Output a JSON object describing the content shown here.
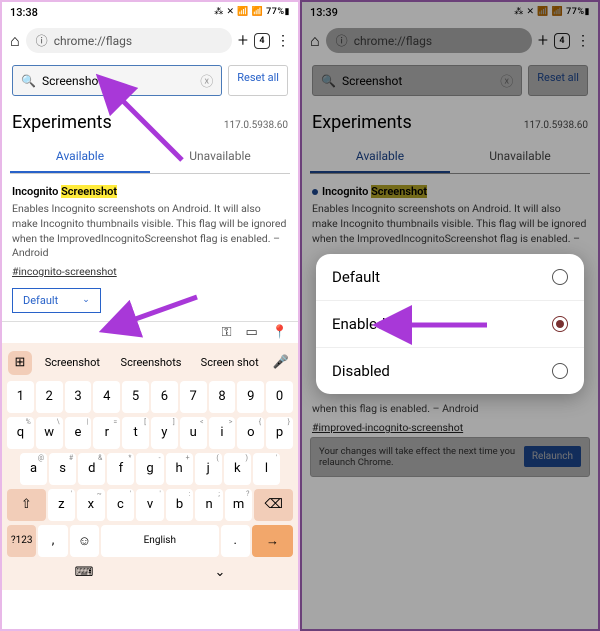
{
  "left": {
    "status": {
      "time": "13:38",
      "icons": "⁂ ✕ 📶 📶 77%▮"
    },
    "nav": {
      "url": "chrome://flags",
      "tabcount": "4"
    },
    "search": {
      "value": "Screenshot",
      "reset": "Reset all"
    },
    "experiments": {
      "title": "Experiments",
      "version": "117.0.5938.60"
    },
    "tabs": {
      "available": "Available",
      "unavailable": "Unavailable"
    },
    "flag": {
      "title_pre": "Incognito ",
      "title_hl": "Screenshot",
      "desc": "Enables Incognito screenshots on Android. It will also make Incognito thumbnails visible. This flag will be ignored when the ImprovedIncognitoScreenshot flag is enabled. – Android",
      "link": "#incognito-screenshot",
      "dropdown": "Default"
    },
    "suggest": {
      "w1": "Screenshot",
      "w2": "Screenshots",
      "w3": "Screen shot"
    },
    "keys": {
      "r1": [
        "1",
        "2",
        "3",
        "4",
        "5",
        "6",
        "7",
        "8",
        "9",
        "0"
      ],
      "r2": [
        "q",
        "w",
        "e",
        "r",
        "t",
        "y",
        "u",
        "i",
        "o",
        "p"
      ],
      "r2sup": [
        "%",
        "\\",
        "|",
        "=",
        "[",
        "]",
        "<",
        ">",
        "{",
        "}"
      ],
      "r3": [
        "a",
        "s",
        "d",
        "f",
        "g",
        "h",
        "j",
        "k",
        "l"
      ],
      "r3sup": [
        "@",
        "#",
        "&",
        "*",
        "-",
        "+",
        "(",
        ")",
        "'"
      ],
      "r4": [
        "z",
        "x",
        "c",
        "v",
        "b",
        "n",
        "m"
      ],
      "r4sup": [
        "'",
        "~",
        "'",
        "'",
        ":",
        ";",
        "?"
      ],
      "shift": "⇧",
      "back": "⌫",
      "num": "?123",
      "emoji": "☺",
      "space": "English",
      "enter": "→"
    }
  },
  "right": {
    "status": {
      "time": "13:39",
      "icons": "⁂ ✕ 📶 📶 77%▮"
    },
    "nav": {
      "url": "chrome://flags",
      "tabcount": "4"
    },
    "search": {
      "value": "Screenshot",
      "reset": "Reset all"
    },
    "experiments": {
      "title": "Experiments",
      "version": "117.0.5938.60"
    },
    "tabs": {
      "available": "Available",
      "unavailable": "Unavailable"
    },
    "flag": {
      "title_pre": "Incognito ",
      "title_hl": "Screenshot",
      "desc": "Enables Incognito screenshots on Android. It will also make Incognito thumbnails visible. This flag will be ignored when the ImprovedIncognitoScreenshot flag is enabled. –",
      "dropdown": "Default"
    },
    "improved": {
      "desc": "when this flag is enabled. – Android",
      "link": "#improved-incognito-screenshot"
    },
    "popup": {
      "o1": "Default",
      "o2": "Enabled",
      "o3": "Disabled"
    },
    "snack": {
      "msg": "Your changes will take effect the next time you relaunch Chrome.",
      "btn": "Relaunch"
    }
  }
}
